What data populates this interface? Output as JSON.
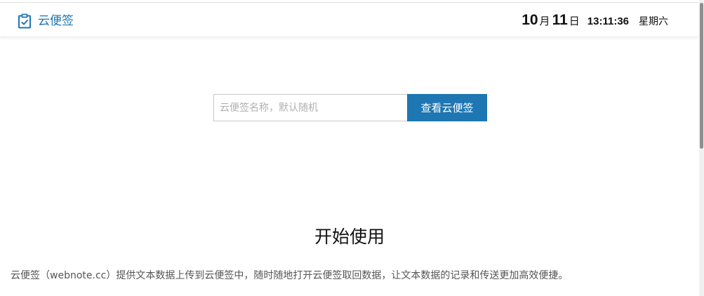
{
  "header": {
    "brand": "云便签",
    "brand_icon": "clipboard-check-icon",
    "brand_color": "#1e76b3",
    "date": {
      "month": "10",
      "month_unit": "月",
      "day": "11",
      "day_unit": "日",
      "time": "13:11:36",
      "weekday": "星期六"
    }
  },
  "search": {
    "placeholder": "云便签名称，默认随机",
    "value": "",
    "button_label": "查看云便签"
  },
  "intro": {
    "title": "开始使用",
    "text": "云便签（webnote.cc）提供文本数据上传到云便签中，随时随地打开云便签取回数据，让文本数据的记录和传送更加高效便捷。"
  },
  "colors": {
    "accent": "#1e76b3",
    "text": "#111111",
    "muted": "#555555"
  }
}
